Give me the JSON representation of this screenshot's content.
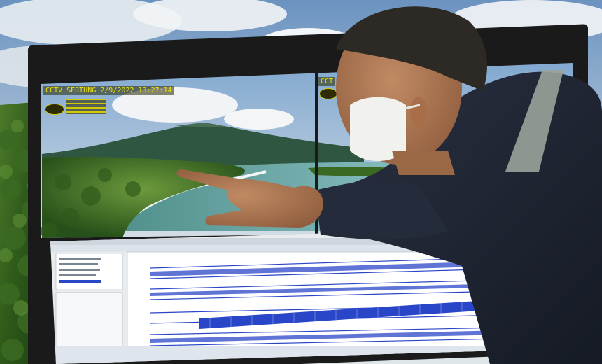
{
  "cctv_overlay": {
    "title_text": "CCTV SERTUNG 2/9/2022 13:27:14",
    "right_title_text": "CCT",
    "info_line_1": "",
    "info_line_2": ""
  },
  "seismogram_app": {
    "title": "",
    "panel_list": [
      "",
      "",
      "",
      "",
      ""
    ]
  },
  "colors": {
    "sky_top": "#5e8ec1",
    "seismo_trace": "#2a46c8",
    "osd_text": "#f0e400",
    "jacket": "#1f2533",
    "mask": "#f1f1ee"
  },
  "icons": [
    "cctv-logo-icon"
  ]
}
